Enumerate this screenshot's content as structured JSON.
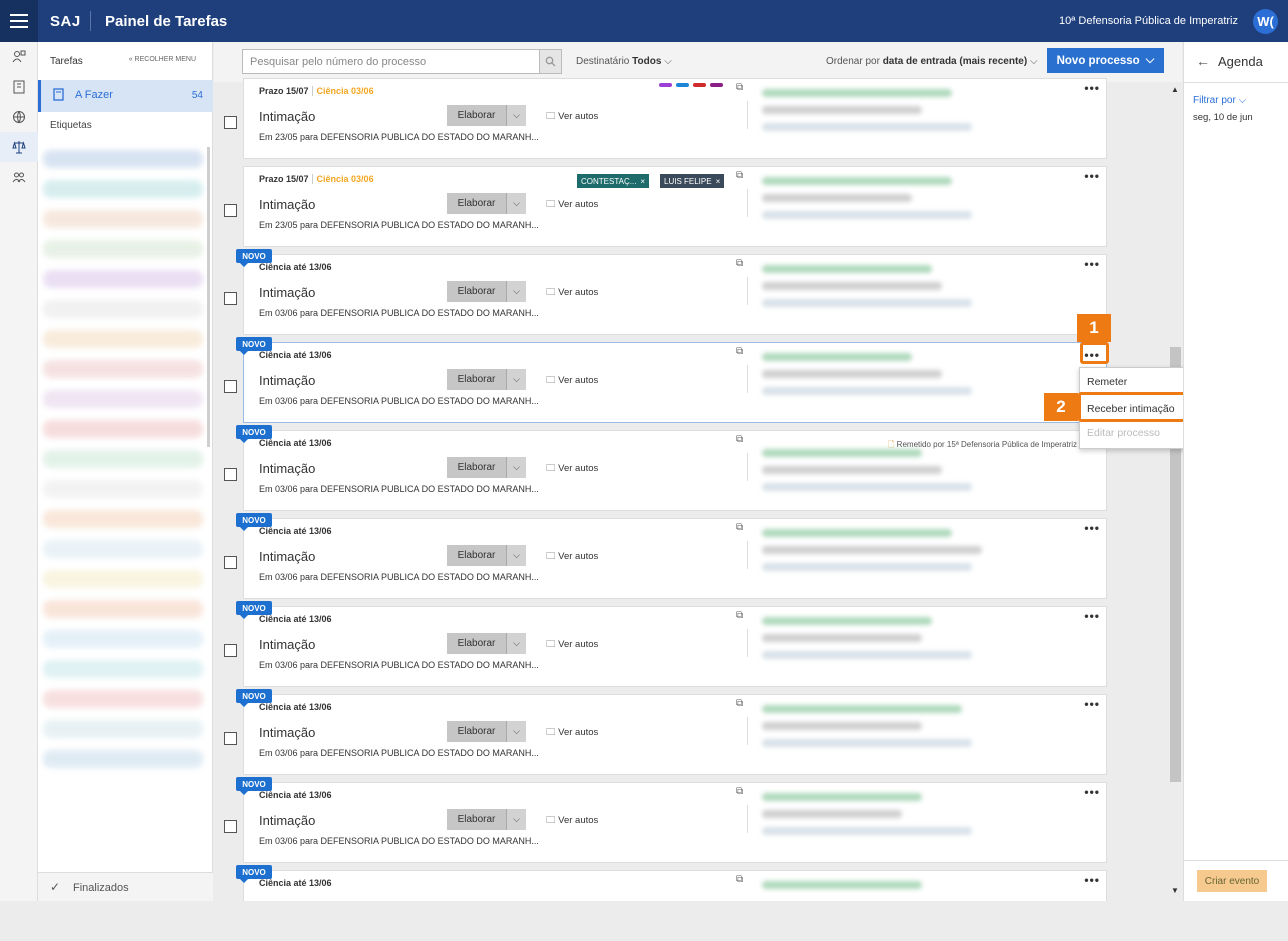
{
  "header": {
    "brand": "SAJ",
    "title": "Painel de Tarefas",
    "org": "10ª Defensoria Pública de Imperatriz",
    "avatar": "W("
  },
  "sidebar": {
    "tarefas_label": "Tarefas",
    "collapse_label": "« RECOLHER MENU",
    "afazer_label": "A Fazer",
    "afazer_count": "54",
    "etiquetas_label": "Etiquetas",
    "finalizados_label": "Finalizados"
  },
  "toolbar": {
    "search_placeholder": "Pesquisar pelo número do processo",
    "dest_label": "Destinatário",
    "dest_value": "Todos",
    "order_label": "Ordenar por",
    "order_value": "data de entrada (mais recente)",
    "novo_processo": "Novo processo"
  },
  "cards": [
    {
      "novo": false,
      "date": "Prazo 15/07",
      "ciencia": "Ciência 03/06",
      "title": "Intimação",
      "elaborar": "Elaborar",
      "ver_autos": "Ver autos",
      "desc": "Em 23/05 para DEFENSORIA PUBLICA DO ESTADO DO MARANH...",
      "tags": [
        "#9b3fd6",
        "#1e86d8",
        "#d02a2a",
        "#8a1f85"
      ]
    },
    {
      "novo": false,
      "date": "Prazo 15/07",
      "ciencia": "Ciência 03/06",
      "title": "Intimação",
      "elaborar": "Elaborar",
      "ver_autos": "Ver autos",
      "desc": "Em 23/05 para DEFENSORIA PUBLICA DO ESTADO DO MARANH...",
      "chips": [
        "CONTESTAÇ...",
        "LUIS FELIPE"
      ]
    },
    {
      "novo": true,
      "novo_label": "NOVO",
      "date": "Ciência até 13/06",
      "title": "Intimação",
      "elaborar": "Elaborar",
      "ver_autos": "Ver autos",
      "desc": "Em 03/06 para DEFENSORIA PUBLICA DO ESTADO DO MARANH..."
    },
    {
      "novo": true,
      "novo_label": "NOVO",
      "date": "Ciência até 13/06",
      "title": "Intimação",
      "elaborar": "Elaborar",
      "ver_autos": "Ver autos",
      "desc": "Em 03/06 para DEFENSORIA PUBLICA DO ESTADO DO MARANH..."
    },
    {
      "novo": true,
      "novo_label": "NOVO",
      "date": "Ciência até 13/06",
      "title": "Intimação",
      "elaborar": "Elaborar",
      "ver_autos": "Ver autos",
      "desc": "Em 03/06 para DEFENSORIA PUBLICA DO ESTADO DO MARANH...",
      "remetido": "Remetido por 15ª Defensoria Pública de Imperatriz"
    },
    {
      "novo": true,
      "novo_label": "NOVO",
      "date": "Ciência até 13/06",
      "title": "Intimação",
      "elaborar": "Elaborar",
      "ver_autos": "Ver autos",
      "desc": "Em 03/06 para DEFENSORIA PUBLICA DO ESTADO DO MARANH..."
    },
    {
      "novo": true,
      "novo_label": "NOVO",
      "date": "Ciência até 13/06",
      "title": "Intimação",
      "elaborar": "Elaborar",
      "ver_autos": "Ver autos",
      "desc": "Em 03/06 para DEFENSORIA PUBLICA DO ESTADO DO MARANH..."
    },
    {
      "novo": true,
      "novo_label": "NOVO",
      "date": "Ciência até 13/06",
      "title": "Intimação",
      "elaborar": "Elaborar",
      "ver_autos": "Ver autos",
      "desc": "Em 03/06 para DEFENSORIA PUBLICA DO ESTADO DO MARANH..."
    },
    {
      "novo": true,
      "novo_label": "NOVO",
      "date": "Ciência até 13/06",
      "title": "Intimação",
      "elaborar": "Elaborar",
      "ver_autos": "Ver autos",
      "desc": "Em 03/06 para DEFENSORIA PUBLICA DO ESTADO DO MARANH..."
    },
    {
      "novo": true,
      "novo_label": "NOVO",
      "date": "Ciência até 13/06",
      "title": "",
      "elaborar": "",
      "ver_autos": "",
      "desc": ""
    }
  ],
  "context_menu": {
    "items": [
      "Remeter",
      "Receber intimação",
      "Editar processo"
    ]
  },
  "callouts": [
    "1",
    "2"
  ],
  "agenda": {
    "title": "Agenda",
    "filtrar": "Filtrar por",
    "date": "seg, 10 de jun",
    "criar": "Criar evento"
  },
  "colors": {
    "header": "#1e3f7c",
    "accent": "#2a70cf",
    "callout": "#ee7a14",
    "novo_badge": "#1d6fd0",
    "chip": "#1e6b6b",
    "chip2": "#3b4a5a"
  }
}
